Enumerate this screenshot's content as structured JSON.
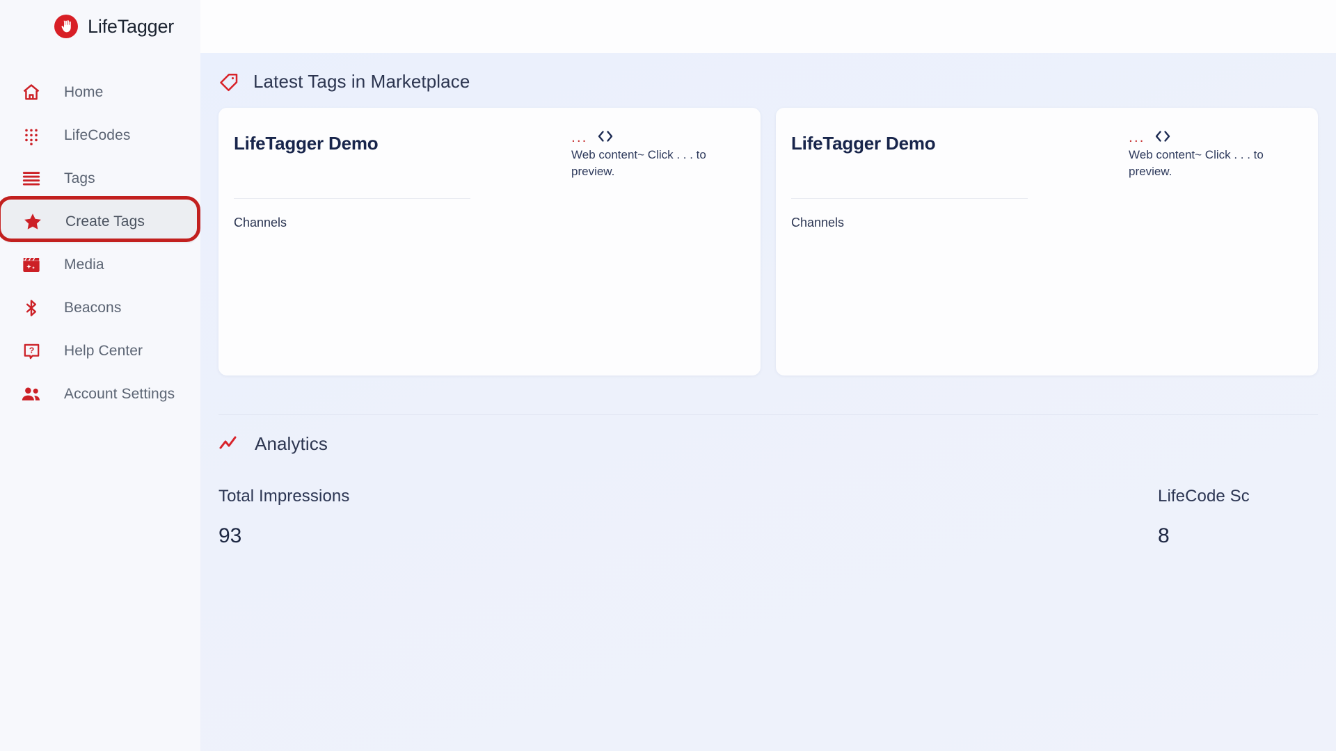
{
  "brand": {
    "name": "LifeTagger",
    "logo_icon": "hand-icon",
    "accent": "#d81f26"
  },
  "sidebar": {
    "items": [
      {
        "label": "Home",
        "icon": "home-icon",
        "active": false
      },
      {
        "label": "LifeCodes",
        "icon": "dot-grid-icon",
        "active": false
      },
      {
        "label": "Tags",
        "icon": "stacked-lines-icon",
        "active": false
      },
      {
        "label": "Create Tags",
        "icon": "star-icon",
        "active": true
      },
      {
        "label": "Media",
        "icon": "clapperboard-icon",
        "active": false
      },
      {
        "label": "Beacons",
        "icon": "bluetooth-icon",
        "active": false
      },
      {
        "label": "Help Center",
        "icon": "question-bubble-icon",
        "active": false
      },
      {
        "label": "Account Settings",
        "icon": "people-icon",
        "active": false
      }
    ]
  },
  "marketplace": {
    "title": "Latest Tags in Marketplace",
    "icon": "tag-icon",
    "cards": [
      {
        "title": "LifeTagger Demo",
        "menu": "...",
        "code_icon": "code-brackets-icon",
        "description": "Web content~ Click . . . to preview.",
        "sub_label": "Channels"
      },
      {
        "title": "LifeTagger Demo",
        "menu": "...",
        "code_icon": "code-brackets-icon",
        "description": "Web content~ Click . . . to preview.",
        "sub_label": "Channels"
      }
    ]
  },
  "analytics": {
    "title": "Analytics",
    "icon": "trend-line-icon",
    "metrics": [
      {
        "label": "Total Impressions",
        "value": "93"
      },
      {
        "label": "LifeCode Sc",
        "value": "8"
      }
    ]
  }
}
